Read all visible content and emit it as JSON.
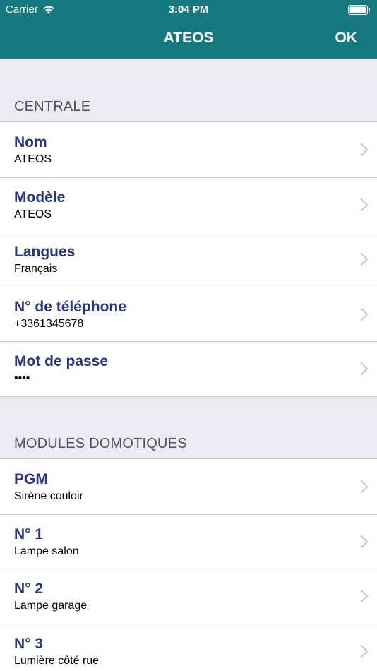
{
  "status_bar": {
    "carrier": "Carrier",
    "time": "3:04 PM"
  },
  "nav": {
    "title": "ATEOS",
    "ok_label": "OK"
  },
  "colors": {
    "nav_bg": "#16797f",
    "title_text": "#27348b",
    "background": "#ebebf1"
  },
  "section_centrale": {
    "header": "CENTRALE",
    "items": [
      {
        "title": "Nom",
        "subtitle": "ATEOS"
      },
      {
        "title": "Modèle",
        "subtitle": "ATEOS"
      },
      {
        "title": "Langues",
        "subtitle": "Français"
      },
      {
        "title": "N° de téléphone",
        "subtitle": "+3361345678"
      },
      {
        "title": "Mot de passe",
        "subtitle": "••••"
      }
    ]
  },
  "section_modules": {
    "header": "MODULES DOMOTIQUES",
    "items": [
      {
        "title": "PGM",
        "subtitle": "Sirène couloir"
      },
      {
        "title": "N° 1",
        "subtitle": "Lampe salon"
      },
      {
        "title": "N° 2",
        "subtitle": "Lampe garage"
      },
      {
        "title": "N° 3",
        "subtitle": "Lumière côté rue"
      }
    ]
  }
}
